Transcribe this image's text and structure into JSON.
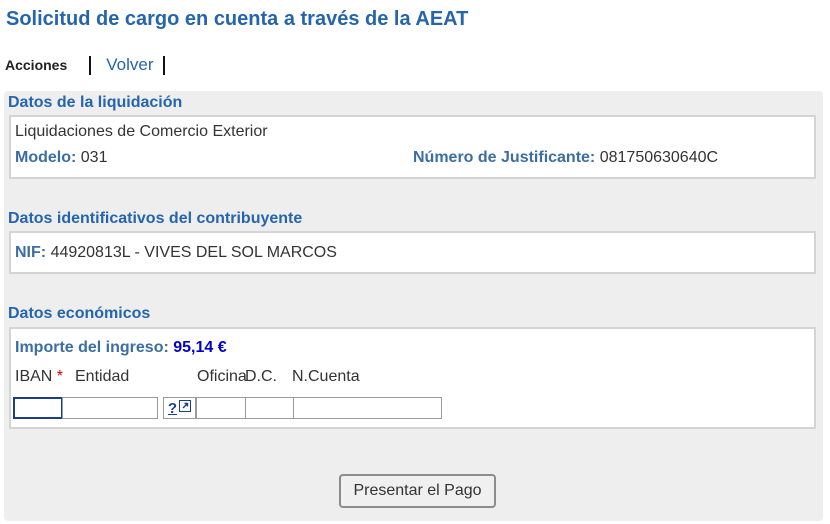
{
  "page": {
    "title": "Solicitud de cargo en cuenta a través de la AEAT"
  },
  "actions": {
    "label": "Acciones",
    "volver": "Volver"
  },
  "liquidacion": {
    "section_title": "Datos de la liquidación",
    "description": "Liquidaciones de Comercio Exterior",
    "modelo_label": "Modelo:",
    "modelo_value": "031",
    "justificante_label": "Número de Justificante:",
    "justificante_value": "081750630640C"
  },
  "contribuyente": {
    "section_title": "Datos identificativos del contribuyente",
    "nif_label": "NIF:",
    "nif_value": "44920813L - VIVES DEL SOL MARCOS"
  },
  "economicos": {
    "section_title": "Datos económicos",
    "importe_label": "Importe del ingreso:",
    "importe_value": "95,14 €",
    "iban_label": "IBAN",
    "required_mark": "*",
    "entidad_label": "Entidad",
    "oficina_label": "Oficina",
    "dc_label": "D.C.",
    "cuenta_label": "N.Cuenta",
    "help_label": "?",
    "help_icon": "external-link-icon",
    "iban_value": "",
    "entidad_value": "",
    "oficina_value": "",
    "dc_value": "",
    "cuenta_value": ""
  },
  "buttons": {
    "submit": "Presentar el Pago"
  }
}
